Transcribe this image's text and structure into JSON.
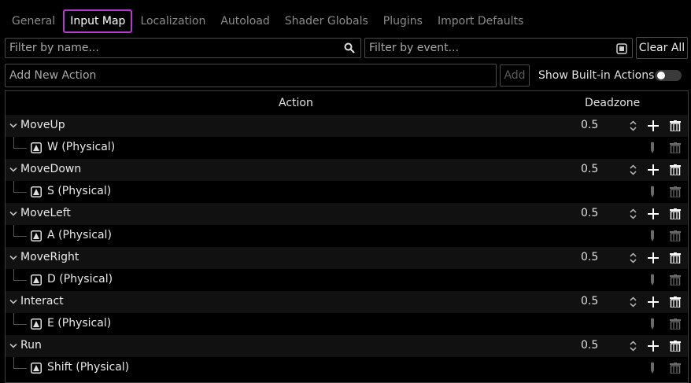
{
  "tabs": [
    {
      "label": "General",
      "active": false
    },
    {
      "label": "Input Map",
      "active": true
    },
    {
      "label": "Localization",
      "active": false
    },
    {
      "label": "Autoload",
      "active": false
    },
    {
      "label": "Shader Globals",
      "active": false
    },
    {
      "label": "Plugins",
      "active": false
    },
    {
      "label": "Import Defaults",
      "active": false
    }
  ],
  "filter": {
    "name_placeholder": "Filter by name...",
    "event_placeholder": "Filter by event...",
    "clear_all_label": "Clear All"
  },
  "add_action": {
    "placeholder": "Add New Action",
    "add_label": "Add",
    "show_builtin_label": "Show Built-in Actions",
    "show_builtin_on": false
  },
  "tree": {
    "header_action": "Action",
    "header_deadzone": "Deadzone",
    "actions": [
      {
        "name": "MoveUp",
        "deadzone": "0.5",
        "event": "W (Physical)"
      },
      {
        "name": "MoveDown",
        "deadzone": "0.5",
        "event": "S (Physical)"
      },
      {
        "name": "MoveLeft",
        "deadzone": "0.5",
        "event": "A (Physical)"
      },
      {
        "name": "MoveRight",
        "deadzone": "0.5",
        "event": "D (Physical)"
      },
      {
        "name": "Interact",
        "deadzone": "0.5",
        "event": "E (Physical)"
      },
      {
        "name": "Run",
        "deadzone": "0.5",
        "event": "Shift (Physical)"
      }
    ]
  },
  "colors": {
    "accent": "#b73ad0",
    "background": "#000000",
    "action_row": "#111111"
  },
  "icons": {
    "search": "search-icon",
    "keyboard": "keyboard-icon",
    "collapse": "chevron-down-icon",
    "key_event": "key-event-icon",
    "spin": "spin-arrows-icon",
    "add": "plus-icon",
    "remove": "trash-icon",
    "edit": "pencil-icon"
  }
}
